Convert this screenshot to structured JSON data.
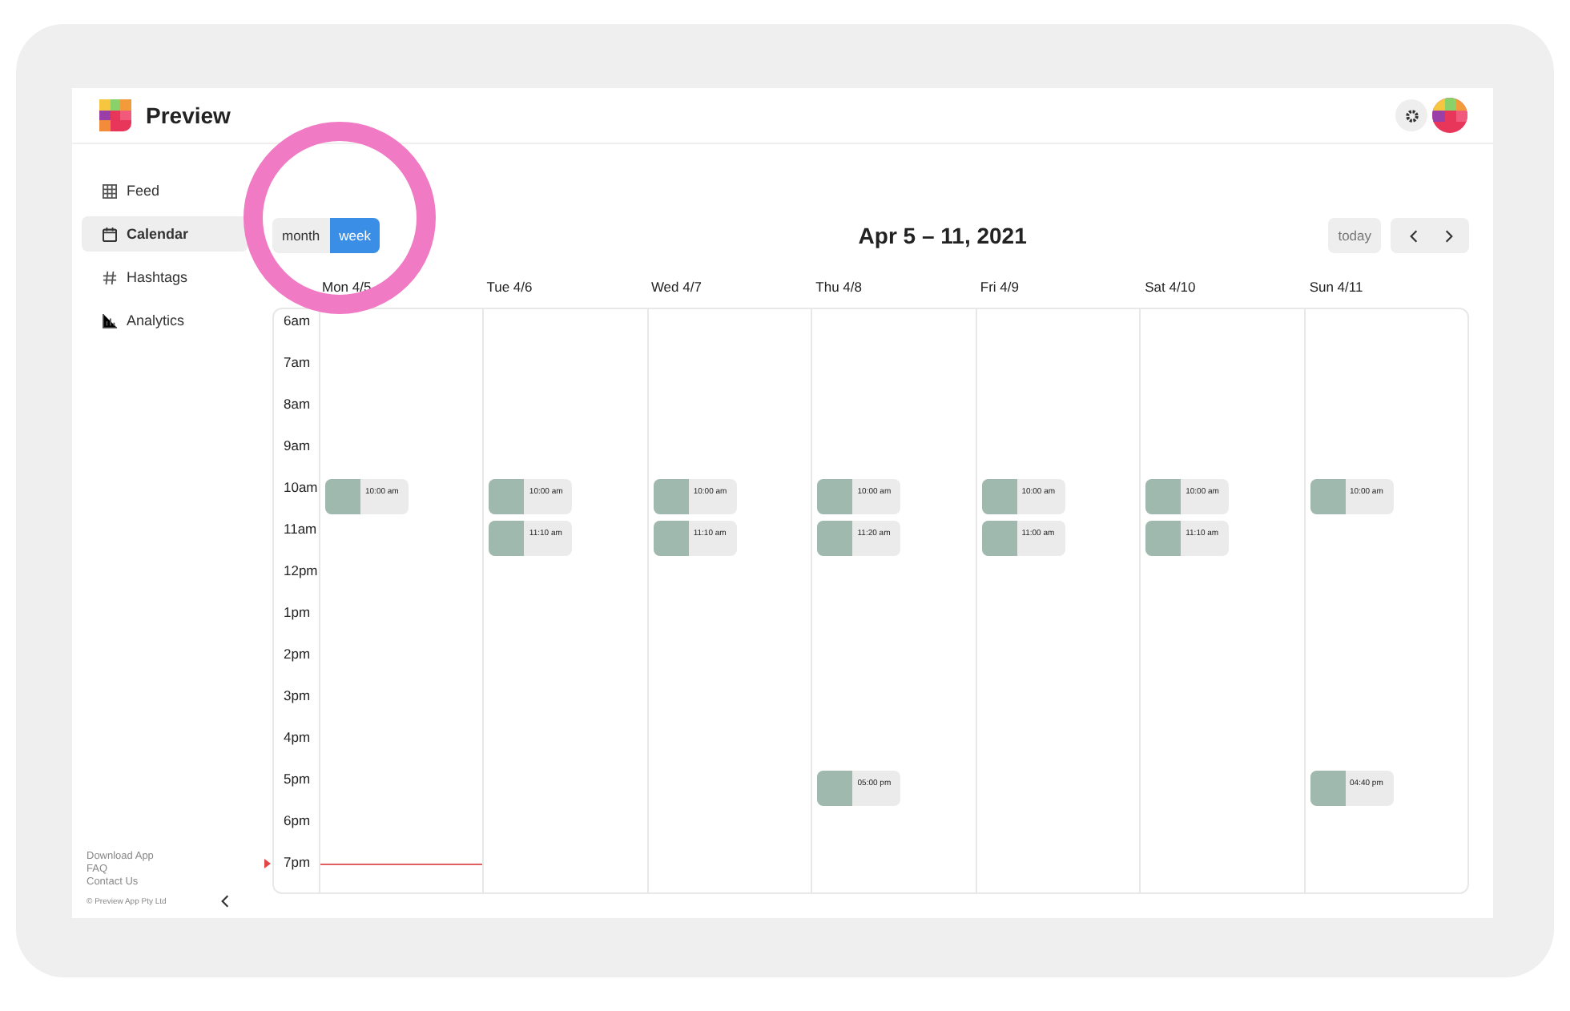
{
  "app": {
    "name": "Preview"
  },
  "sidebar": {
    "items": [
      {
        "label": "Feed",
        "kind": "grid",
        "selected": false
      },
      {
        "label": "Calendar",
        "kind": "calendar",
        "selected": true
      },
      {
        "label": "Hashtags",
        "kind": "hash",
        "selected": false
      },
      {
        "label": "Analytics",
        "kind": "chart",
        "selected": false
      }
    ],
    "footer_links": [
      "Download App",
      "FAQ",
      "Contact Us"
    ],
    "copyright": "© Preview App Pty Ltd"
  },
  "view_toggle": [
    {
      "label": "month",
      "selected": false
    },
    {
      "label": "week",
      "selected": true
    }
  ],
  "title": "Apr 5 – 11, 2021",
  "today_button": "today",
  "days": [
    "Mon 4/5",
    "Tue 4/6",
    "Wed 4/7",
    "Thu 4/8",
    "Fri 4/9",
    "Sat 4/10",
    "Sun 4/11"
  ],
  "hours": [
    {
      "label": "6am",
      "now": false
    },
    {
      "label": "7am",
      "now": false
    },
    {
      "label": "8am",
      "now": false
    },
    {
      "label": "9am",
      "now": false
    },
    {
      "label": "10am",
      "now": false,
      "cells": [
        [
          {
            "time": "10:00 am"
          }
        ],
        [
          {
            "time": "10:00 am"
          }
        ],
        [
          {
            "time": "10:00 am"
          }
        ],
        [
          {
            "time": "10:00 am"
          }
        ],
        [
          {
            "time": "10:00 am"
          }
        ],
        [
          {
            "time": "10:00 am"
          }
        ],
        [
          {
            "time": "10:00 am"
          }
        ]
      ]
    },
    {
      "label": "11am",
      "now": false,
      "cells": [
        [],
        [
          {
            "time": "11:10 am"
          }
        ],
        [
          {
            "time": "11:10 am"
          }
        ],
        [
          {
            "time": "11:20 am"
          }
        ],
        [
          {
            "time": "11:00 am"
          }
        ],
        [
          {
            "time": "11:10 am"
          }
        ],
        []
      ]
    },
    {
      "label": "12pm",
      "now": false
    },
    {
      "label": "1pm",
      "now": false
    },
    {
      "label": "2pm",
      "now": false
    },
    {
      "label": "3pm",
      "now": false
    },
    {
      "label": "4pm",
      "now": false
    },
    {
      "label": "5pm",
      "now": false,
      "cells": [
        [],
        [],
        [],
        [
          {
            "time": "05:00 pm"
          }
        ],
        [],
        [],
        [
          {
            "time": "04:40 pm"
          }
        ]
      ]
    },
    {
      "label": "6pm",
      "now": false
    },
    {
      "label": "7pm",
      "now": true
    }
  ]
}
